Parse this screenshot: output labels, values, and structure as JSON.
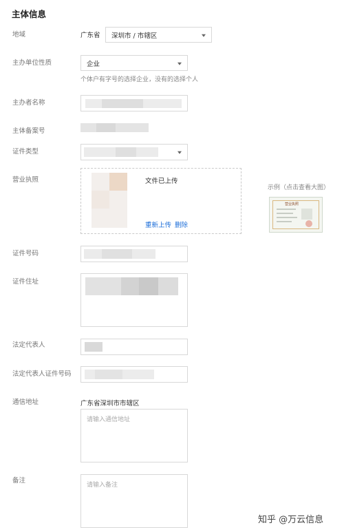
{
  "section": {
    "title": "主体信息"
  },
  "labels": {
    "region": "地域",
    "unit_nature": "主办单位性质",
    "sponsor_name": "主办者名称",
    "record_no": "主体备案号",
    "cert_type": "证件类型",
    "business_license": "营业执照",
    "cert_number": "证件号码",
    "cert_address": "证件住址",
    "legal_rep": "法定代表人",
    "legal_rep_id": "法定代表人证件号码",
    "mail_address": "通信地址",
    "remark": "备注"
  },
  "region": {
    "province": "广东省",
    "city_district": "深圳市 / 市辖区"
  },
  "unit_nature": {
    "value": "企业",
    "hint": "个体户有字号的选择企业，没有的选择个人"
  },
  "upload": {
    "status": "文件已上传",
    "reupload": "重新上传",
    "delete": "删除"
  },
  "example": {
    "label": "示例（点击查看大图）",
    "cert_title": "营业执照"
  },
  "mail": {
    "prefix": "广东省深圳市市辖区",
    "placeholder": "请输入通信地址"
  },
  "remark": {
    "placeholder": "请输入备注"
  },
  "watermark": "知乎 @万云信息"
}
